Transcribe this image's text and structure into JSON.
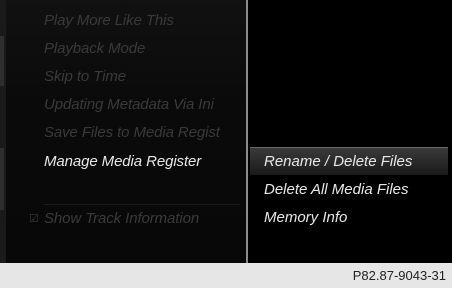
{
  "left_menu": {
    "items": [
      {
        "label": "Play More Like This",
        "active": false
      },
      {
        "label": "Playback Mode",
        "active": false
      },
      {
        "label": "Skip to Time",
        "active": false
      },
      {
        "label": "Updating Metadata Via Ini",
        "active": false
      },
      {
        "label": "Save Files to Media Regist",
        "active": false
      },
      {
        "label": "Manage Media Register",
        "active": true
      },
      {
        "label": "Show Track Information",
        "active": false
      }
    ]
  },
  "submenu": {
    "items": [
      {
        "label": "Rename / Delete Files",
        "selected": true
      },
      {
        "label": "Delete All Media Files",
        "selected": false
      },
      {
        "label": "Memory Info",
        "selected": false
      }
    ]
  },
  "caption": "P82.87-9043-31",
  "icons": {
    "checkbox": "checkbox-checked-icon"
  },
  "colors": {
    "screen_bg": "#000000",
    "active_text": "#e8e8e8",
    "inactive_text": "#3a3a3a",
    "highlight": "#3a3a3a"
  }
}
